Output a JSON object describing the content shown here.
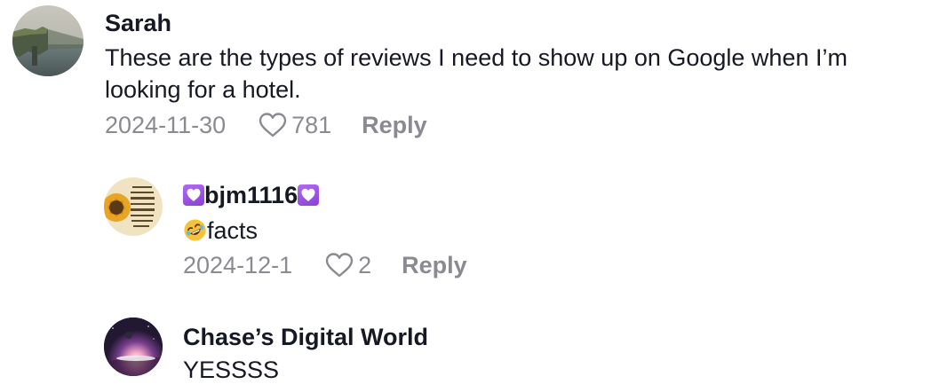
{
  "comments": [
    {
      "author": "Sarah",
      "text": "These are the types of reviews I need to show up on Google when I’m looking for a hotel.",
      "date": "2024-11-30",
      "likes": "781",
      "reply_label": "Reply",
      "avatar_icon": "cliff-photo-avatar"
    }
  ],
  "replies": [
    {
      "author": "bjm1116",
      "author_decoration_icon": "purple-heart-icon",
      "text": "facts",
      "text_prefix_icon": "rolling-laughing-emoji-icon",
      "date": "2024-12-1",
      "likes": "2",
      "reply_label": "Reply",
      "avatar_icon": "sunflower-quote-avatar"
    },
    {
      "author": "Chase’s Digital World",
      "text": "YESSSS",
      "avatar_icon": "space-galaxy-avatar"
    }
  ],
  "colors": {
    "text_primary": "#161823",
    "text_secondary": "#8a8b91",
    "heart_emoji": "#9b4fe0"
  }
}
